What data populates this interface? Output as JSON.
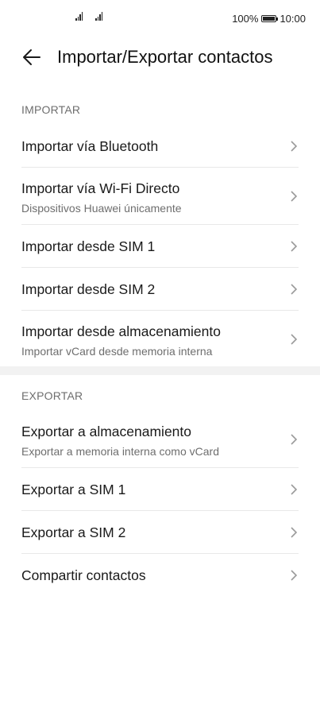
{
  "status_bar": {
    "battery_percent": "100%",
    "time": "10:00",
    "icons": [
      "signal-icon",
      "signal-icon",
      "battery-icon"
    ]
  },
  "app_bar": {
    "title": "Importar/Exportar contactos",
    "back_icon": "back-arrow-icon"
  },
  "import_section": {
    "header": "IMPORTAR",
    "items": [
      {
        "title": "Importar vía Bluetooth",
        "subtitle": ""
      },
      {
        "title": "Importar vía Wi-Fi Directo",
        "subtitle": "Dispositivos Huawei únicamente"
      },
      {
        "title": "Importar desde SIM 1",
        "subtitle": ""
      },
      {
        "title": "Importar desde SIM 2",
        "subtitle": ""
      },
      {
        "title": "Importar desde almacenamiento",
        "subtitle": "Importar vCard desde memoria interna"
      }
    ]
  },
  "export_section": {
    "header": "EXPORTAR",
    "items": [
      {
        "title": "Exportar a almacenamiento",
        "subtitle": "Exportar a memoria interna como vCard"
      },
      {
        "title": "Exportar a SIM 1",
        "subtitle": ""
      },
      {
        "title": "Exportar a SIM 2",
        "subtitle": ""
      },
      {
        "title": "Compartir contactos",
        "subtitle": ""
      }
    ]
  }
}
